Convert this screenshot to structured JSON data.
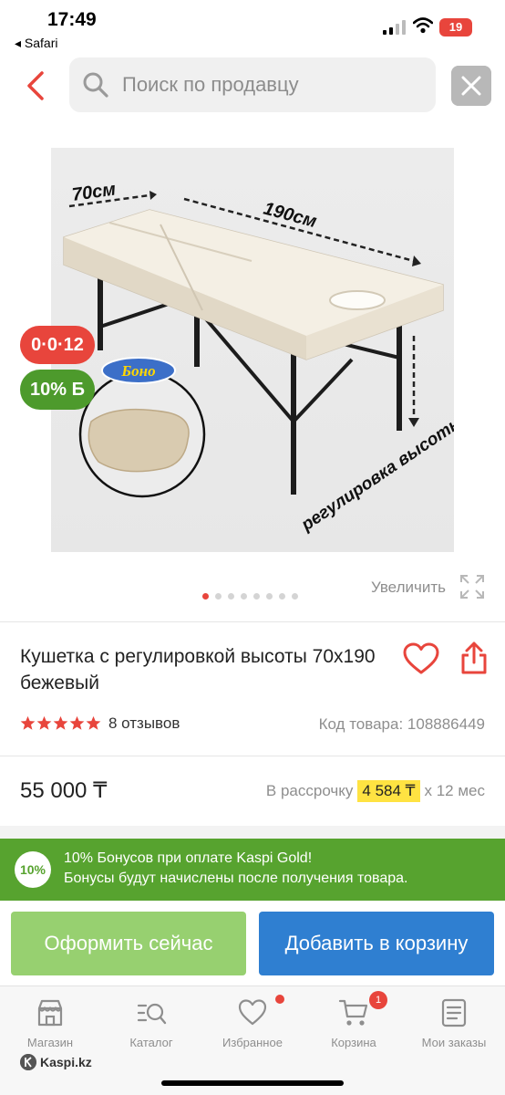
{
  "status_bar": {
    "time": "17:49",
    "back_app": "◂ Safari",
    "battery": "19"
  },
  "search": {
    "placeholder": "Поиск по продавцу"
  },
  "product": {
    "badges": {
      "installment": "0·0·12",
      "bonus": "10%",
      "bonus_currency": "Б"
    },
    "gallery": {
      "slide_count": 8,
      "active_slide": 1,
      "zoom_label": "Увеличить"
    },
    "photo_labels": {
      "width": "70см",
      "length": "190см",
      "brand": "Боно",
      "height": "регулировка высоты"
    },
    "title": "Кушетка с регулировкой высоты 70x190 бежевый",
    "rating": {
      "stars": 5,
      "reviews": "8 отзывов"
    },
    "code": "Код товара: 108886449",
    "price": "55 000 ₸",
    "installment": {
      "prefix": "В рассрочку",
      "amount": "4 584 ₸",
      "suffix": "x 12 мес"
    }
  },
  "promo": {
    "badge": "10%",
    "line1": "10% Бонусов при оплате Kaspi Gold!",
    "line2": "Бонусы будут начислены после получения товара."
  },
  "actions": {
    "buy_now": "Оформить сейчас",
    "add_to_cart": "Добавить в корзину"
  },
  "tabbar": {
    "items": [
      {
        "label": "Магазин",
        "icon": "store-icon"
      },
      {
        "label": "Каталог",
        "icon": "catalog-search-icon"
      },
      {
        "label": "Избранное",
        "icon": "heart-icon"
      },
      {
        "label": "Корзина",
        "icon": "cart-icon",
        "count": "1"
      },
      {
        "label": "Мои заказы",
        "icon": "orders-icon"
      }
    ]
  },
  "footer": {
    "site": "Kaspi.kz"
  },
  "colors": {
    "accent_red": "#e8453c",
    "green": "#57a32f",
    "blue": "#2f7fd1",
    "light_green": "#97d070",
    "highlight": "#ffe342"
  }
}
